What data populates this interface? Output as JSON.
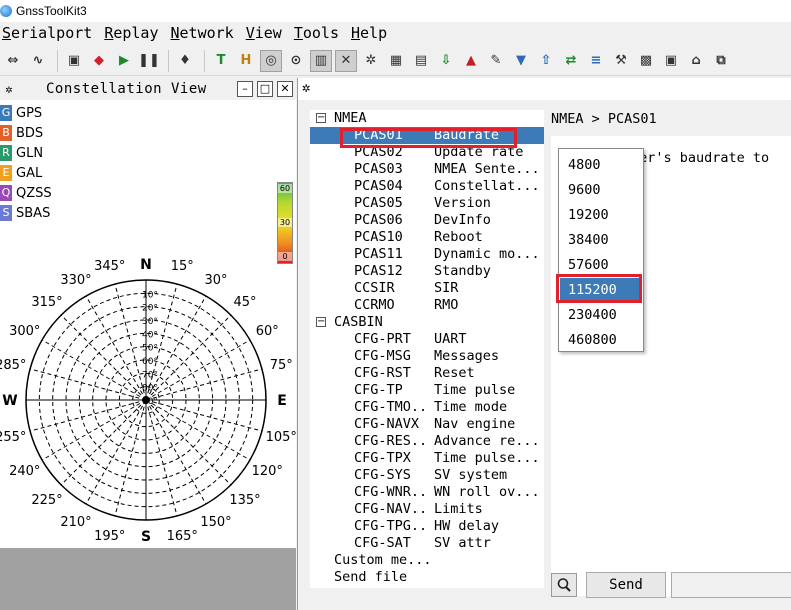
{
  "app": {
    "title": "GnssToolKit3"
  },
  "menu": [
    {
      "u": "S",
      "rest": "erialport"
    },
    {
      "u": "R",
      "rest": "eplay"
    },
    {
      "u": "N",
      "rest": "etwork"
    },
    {
      "u": "V",
      "rest": "iew"
    },
    {
      "u": "T",
      "rest": "ools"
    },
    {
      "u": "H",
      "rest": "elp"
    }
  ],
  "toolbar": {
    "icons": [
      "connect-icon",
      "signal-icon",
      "save-icon",
      "erase-icon",
      "play-icon",
      "pause-icon",
      "mic-icon",
      "text-icon",
      "h-icon",
      "compass-icon",
      "target-icon",
      "bars-icon",
      "satellite-icon",
      "gear-icon",
      "table-icon",
      "chart-icon",
      "download-icon",
      "map-icon",
      "ruler-icon",
      "pin-icon",
      "upload-icon",
      "arrows-icon",
      "layers-icon",
      "tools-icon",
      "grid-icon",
      "qr-icon",
      "scan-icon",
      "copy-icon"
    ]
  },
  "constellation": {
    "title": "Constellation View",
    "systems": [
      {
        "letter": "G",
        "name": "GPS",
        "color": "#3d7ab8"
      },
      {
        "letter": "B",
        "name": "BDS",
        "color": "#e0622a"
      },
      {
        "letter": "R",
        "name": "GLN",
        "color": "#2a9a6a"
      },
      {
        "letter": "E",
        "name": "GAL",
        "color": "#f0a020"
      },
      {
        "letter": "Q",
        "name": "QZSS",
        "color": "#9a4ab8"
      },
      {
        "letter": "S",
        "name": "SBAS",
        "color": "#6a7ad0"
      }
    ],
    "snr_scale": [
      "60",
      "30",
      "0"
    ],
    "cardinals": {
      "n": "N",
      "s": "S",
      "e": "E",
      "w": "W"
    },
    "azimuth_labels": [
      "15°",
      "30°",
      "45°",
      "60°",
      "75°",
      "105°",
      "120°",
      "135°",
      "150°",
      "165°",
      "195°",
      "210°",
      "225°",
      "240°",
      "255°",
      "285°",
      "300°",
      "315°",
      "330°",
      "345°"
    ],
    "elevation_labels": [
      "10°",
      "20°",
      "30°",
      "40°",
      "50°",
      "60°",
      "70°",
      "80°",
      "90°"
    ]
  },
  "tree": {
    "groups": [
      {
        "name": "NMEA",
        "items": [
          {
            "cmd": "PCAS01",
            "desc": "Baudrate",
            "selected": true
          },
          {
            "cmd": "PCAS02",
            "desc": "Update rate"
          },
          {
            "cmd": "PCAS03",
            "desc": "NMEA Sente..."
          },
          {
            "cmd": "PCAS04",
            "desc": "Constellat..."
          },
          {
            "cmd": "PCAS05",
            "desc": "Version"
          },
          {
            "cmd": "PCAS06",
            "desc": "DevInfo"
          },
          {
            "cmd": "PCAS10",
            "desc": "Reboot"
          },
          {
            "cmd": "PCAS11",
            "desc": "Dynamic mo..."
          },
          {
            "cmd": "PCAS12",
            "desc": "Standby"
          },
          {
            "cmd": "CCSIR",
            "desc": "SIR"
          },
          {
            "cmd": "CCRMO",
            "desc": "RMO"
          }
        ]
      },
      {
        "name": "CASBIN",
        "items": [
          {
            "cmd": "CFG-PRT",
            "desc": "UART"
          },
          {
            "cmd": "CFG-MSG",
            "desc": "Messages"
          },
          {
            "cmd": "CFG-RST",
            "desc": "Reset"
          },
          {
            "cmd": "CFG-TP",
            "desc": "Time pulse"
          },
          {
            "cmd": "CFG-TMO...",
            "desc": "Time mode"
          },
          {
            "cmd": "CFG-NAVX",
            "desc": "Nav engine"
          },
          {
            "cmd": "CFG-RES...",
            "desc": "Advance re..."
          },
          {
            "cmd": "CFG-TPX",
            "desc": "Time pulse..."
          },
          {
            "cmd": "CFG-SYS",
            "desc": "SV system"
          },
          {
            "cmd": "CFG-WNR...",
            "desc": "WN roll ov..."
          },
          {
            "cmd": "CFG-NAV...",
            "desc": "Limits"
          },
          {
            "cmd": "CFG-TPG...",
            "desc": "HW delay"
          },
          {
            "cmd": "CFG-SAT",
            "desc": "SV attr"
          }
        ]
      }
    ],
    "extra": [
      "Custom me...",
      "Send file"
    ]
  },
  "detail": {
    "breadcrumb": "NMEA > PCAS01",
    "description": "ver's baudrate to"
  },
  "baud_dropdown": {
    "options": [
      "4800",
      "9600",
      "19200",
      "38400",
      "57600",
      "115200",
      "230400",
      "460800"
    ],
    "selected": "115200"
  },
  "bottom": {
    "send_label": "Send",
    "send_value": ""
  },
  "colors": {
    "selection": "#3d7ab8",
    "highlight": "#e0202a"
  }
}
